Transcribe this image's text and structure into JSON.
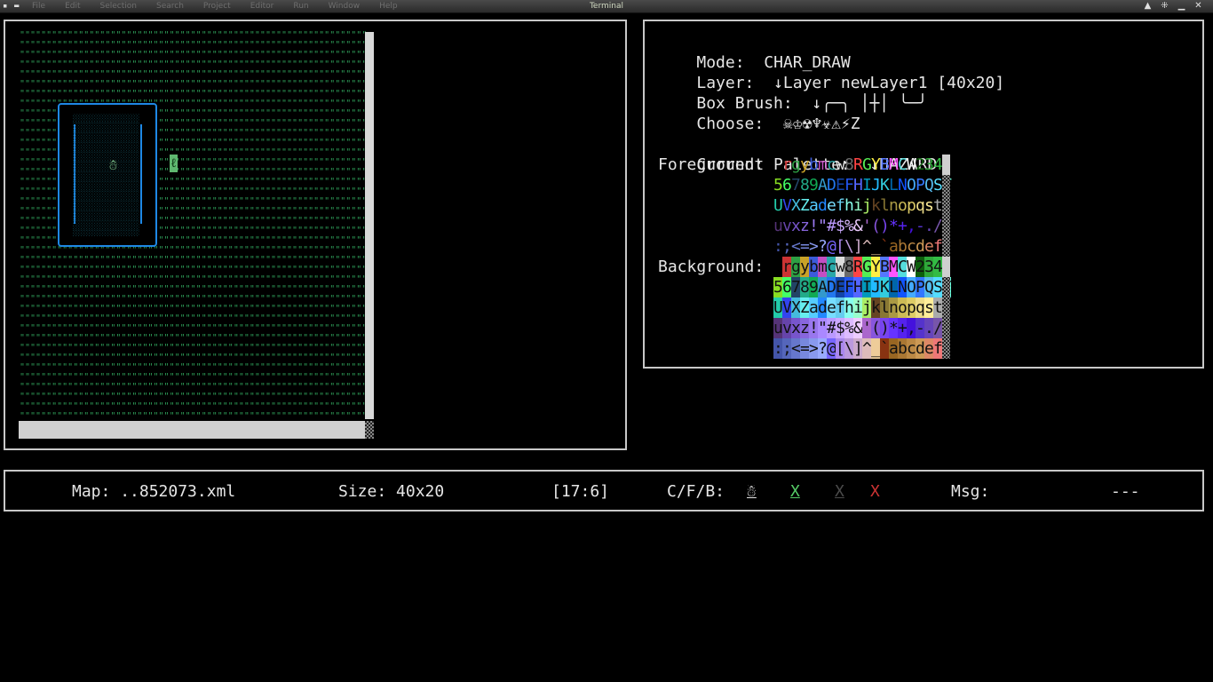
{
  "window": {
    "title": "Terminal",
    "menu_items": [
      "File",
      "Edit",
      "Selection",
      "Search",
      "Project",
      "Editor",
      "Run",
      "Window",
      "Help"
    ],
    "controls": [
      "▲",
      "⁜",
      "▁",
      "✕"
    ]
  },
  "map": {
    "grass_glyph": "\"",
    "floor_glyph": "░",
    "player_glyph": "☃",
    "cursor_glyph": "ℓ"
  },
  "info": {
    "mode_label": "Mode:",
    "mode_value": "CHAR_DRAW",
    "layer_label": "Layer:",
    "layer_value": "↓Layer newLayer1 [40x20]",
    "brush_label": "Box Brush:",
    "brush_value": "↓╭─╮ │┼│ ╰─╯",
    "choose_label": "Choose:",
    "choose_value": "☠♔☢♆☣⚠⚡Z",
    "palette_label": "Current Palette:",
    "palette_value": "↓HAZARD",
    "foreground_label": "Foreground:",
    "background_label": "Background:"
  },
  "palette": {
    "rows": [
      " rgybmcw8RGYBMCW234",
      "56789ADEFHIJKLNOPQST",
      "UVXZadefhijklnopqst",
      "uvxz!\"#$%&'()*+,-./",
      ":;<=>?@[\\]^_`abcdef"
    ],
    "colors": [
      [
        "#000000",
        "#cc3333",
        "#2ea043",
        "#c9a227",
        "#3b5bdb",
        "#c34fc3",
        "#2aa8a8",
        "#dcdcdc",
        "#6b6b6b",
        "#ff4444",
        "#55ee55",
        "#ffee44",
        "#5577ff",
        "#ff55ff",
        "#55dddd",
        "#ffffff",
        "#0d5f0d",
        "#2fa83a",
        "#33bb44"
      ],
      [
        "#88dd22",
        "#44ff66",
        "#224466",
        "#22aa88",
        "#11aa55",
        "#3399cc",
        "#2277ee",
        "#1144aa",
        "#2255ee",
        "#5566ff",
        "#0099bb",
        "#22bbff",
        "#33ccdd",
        "#0066aa",
        "#1155ff",
        "#44aaff",
        "#3377ff",
        "#55bbee",
        "#55ddff",
        "#66ffdd"
      ],
      [
        "#22ccaa",
        "#3344ee",
        "#44bbdd",
        "#66eeee",
        "#55ccff",
        "#2288ff",
        "#77ddff",
        "#66ccee",
        "#88ffee",
        "#99ffcc",
        "#aaee66",
        "#664422",
        "#887733",
        "#aa9944",
        "#ccbb55",
        "#ddcc66",
        "#eedd88",
        "#ffee99",
        "#aaaaaa"
      ],
      [
        "#553377",
        "#6644aa",
        "#7755cc",
        "#8866dd",
        "#9977ee",
        "#aa88ff",
        "#bb99ff",
        "#ccaaff",
        "#ddbbff",
        "#eeccff",
        "#aa66cc",
        "#8855dd",
        "#7744ee",
        "#6633ff",
        "#5522ee",
        "#4411dd",
        "#5533cc",
        "#6644bb",
        "#7755aa"
      ],
      [
        "#4455aa",
        "#5566bb",
        "#6677cc",
        "#7788dd",
        "#8899ee",
        "#99aaff",
        "#7766ff",
        "#aa88ee",
        "#bb99dd",
        "#ccaacc",
        "#ddbbbb",
        "#eecc99",
        "#883311",
        "#996622",
        "#aa7733",
        "#bb8844",
        "#cc9955",
        "#dd8866",
        "#ee7777",
        "#ff6688"
      ]
    ]
  },
  "status": {
    "map_label": "Map:",
    "map_value": "..852073.xml",
    "size_label": "Size:",
    "size_value": "40x20",
    "cursor_value": "[17:6]",
    "cfb_label": "C/F/B:",
    "char_value": "☃",
    "fg_value": "X",
    "bg_value": "X",
    "extra_value": "X",
    "msg_label": "Msg:",
    "msg_value": "---"
  }
}
